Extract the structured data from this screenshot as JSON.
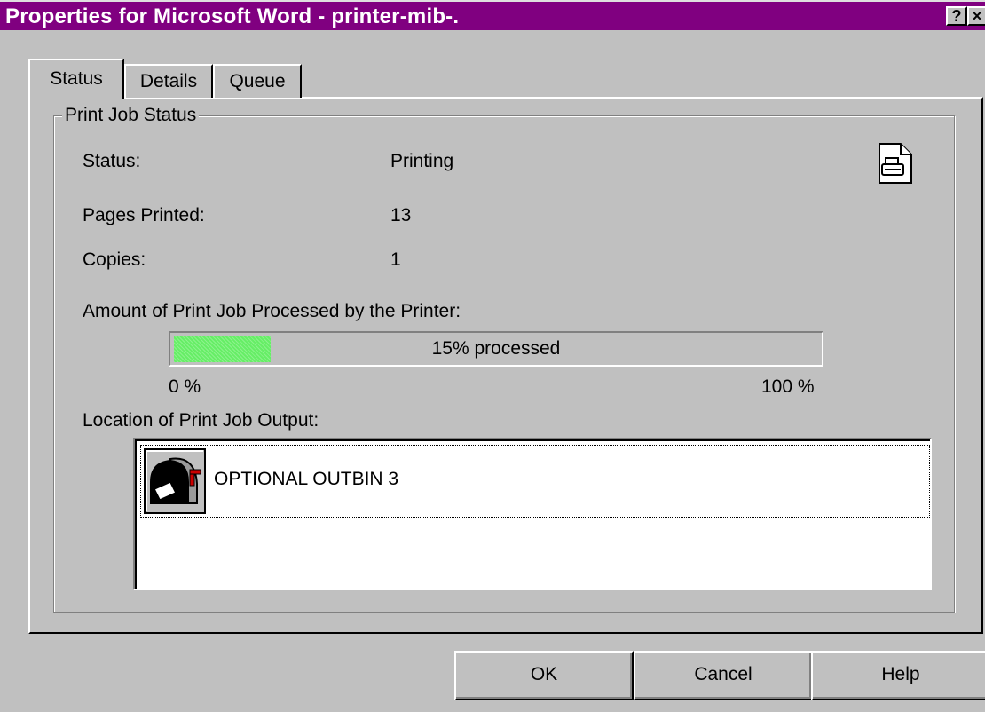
{
  "window": {
    "title": "Properties for Microsoft Word - printer-mib-.",
    "help_button": "?",
    "close_button": "×"
  },
  "tabs": [
    {
      "label": "Status",
      "active": true
    },
    {
      "label": "Details",
      "active": false
    },
    {
      "label": "Queue",
      "active": false
    }
  ],
  "status_group": {
    "title": "Print Job Status",
    "status_label": "Status:",
    "status_value": "Printing",
    "pages_label": "Pages Printed:",
    "pages_value": "13",
    "copies_label": "Copies:",
    "copies_value": "1",
    "amount_label": "Amount of Print Job Processed by the Printer:",
    "progress": {
      "percent": 15,
      "text": "15% processed",
      "min_label": "0 %",
      "max_label": "100 %",
      "fill_color": "#66ee66"
    },
    "location_label": "Location of Print Job Output:",
    "output_items": [
      {
        "label": "OPTIONAL OUTBIN 3",
        "icon": "mailbox-icon"
      }
    ],
    "job_icon": "printer-document-icon"
  },
  "buttons": {
    "ok": "OK",
    "cancel": "Cancel",
    "help": "Help"
  },
  "colors": {
    "title_bar": "#800080",
    "face": "#c0c0c0"
  }
}
